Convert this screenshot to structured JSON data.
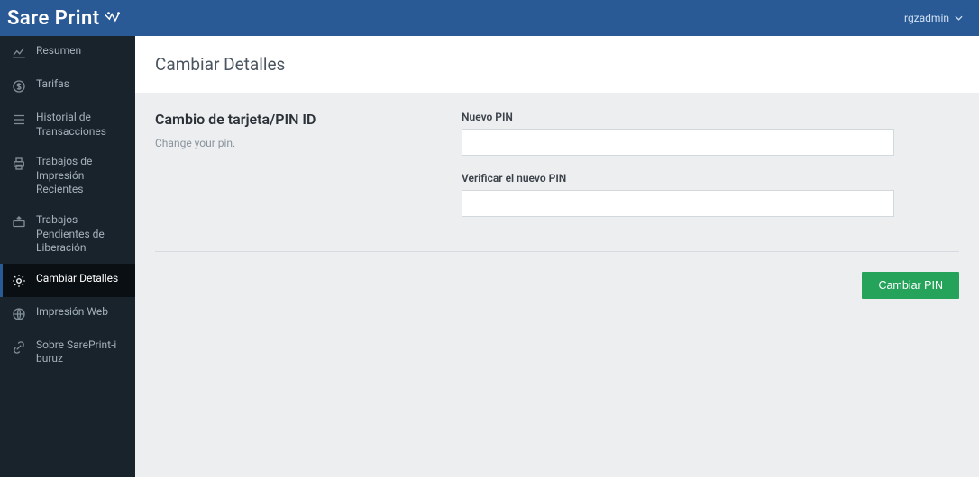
{
  "brand": {
    "name": "Sare Print"
  },
  "user": {
    "name": "rgzadmin"
  },
  "sidebar": {
    "items": [
      {
        "label": "Resumen"
      },
      {
        "label": "Tarifas"
      },
      {
        "label": "Historial de Transacciones"
      },
      {
        "label": "Trabajos de Impresión Recientes"
      },
      {
        "label": "Trabajos Pendientes de Liberación"
      },
      {
        "label": "Cambiar Detalles"
      },
      {
        "label": "Impresión Web"
      },
      {
        "label": "Sobre SarePrint-i buruz"
      }
    ],
    "activeIndex": 5
  },
  "page": {
    "title": "Cambiar Detalles",
    "section_title": "Cambio de tarjeta/PIN ID",
    "section_sub": "Change your pin.",
    "labels": {
      "new_pin": "Nuevo PIN",
      "verify_pin": "Verificar el nuevo PIN"
    },
    "values": {
      "new_pin": "",
      "verify_pin": ""
    },
    "actions": {
      "submit": "Cambiar PIN"
    }
  }
}
